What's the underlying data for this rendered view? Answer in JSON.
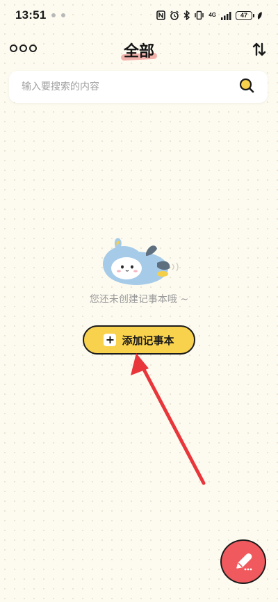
{
  "status_bar": {
    "time": "13:51",
    "network_label": "4G",
    "battery_level": "47"
  },
  "header": {
    "title": "全部",
    "more_icon": "more-dots-icon",
    "sort_icon": "sort-arrows-icon"
  },
  "search": {
    "placeholder": "输入要搜索的内容",
    "icon": "search-icon"
  },
  "empty_state": {
    "message": "您还未创建记事本哦 ~",
    "illustration": "penguin-mascot"
  },
  "add_notebook": {
    "label": "添加记事本",
    "icon": "plus-icon"
  },
  "fab": {
    "icon": "pencil-icon"
  },
  "colors": {
    "background": "#fdfbf0",
    "accent_yellow": "#f9d24d",
    "fab_red": "#f05a5e",
    "annotation_arrow": "#e8363b"
  }
}
